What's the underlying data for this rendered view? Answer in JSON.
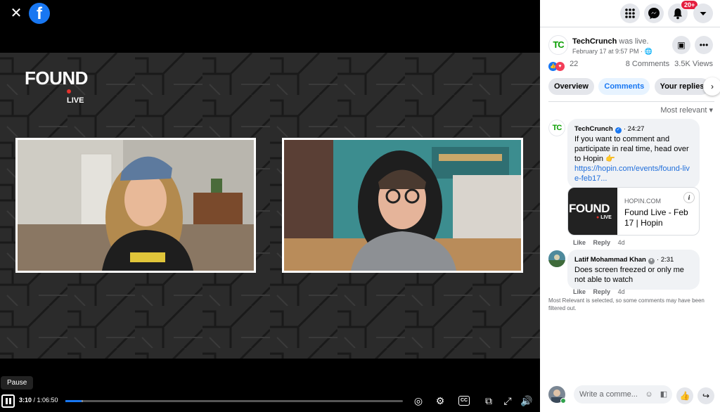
{
  "video": {
    "close_icon": "close-icon",
    "logo_letter": "f",
    "brand_title": "FOUND",
    "brand_live": "LIVE",
    "tooltip": "Pause",
    "time_current": "3:10",
    "time_total": "1:06:50",
    "progress_fraction": 0.047,
    "buffer_fraction": 0.052,
    "cc_label": "CC"
  },
  "topbar": {
    "notif_badge": "20+"
  },
  "post": {
    "page_name": "TechCrunch",
    "page_logo": "TC",
    "status": "was live.",
    "timestamp": "February 17 at 9:57 PM ·",
    "reactions_count": "22",
    "comments_count": "8 Comments",
    "views_count": "3.5K Views"
  },
  "tabs": [
    {
      "label": "Overview"
    },
    {
      "label": "Comments"
    },
    {
      "label": "Your replies"
    }
  ],
  "sort_label": "Most relevant",
  "comments": [
    {
      "author": "TechCrunch",
      "time": "24:27",
      "text": "If you want to comment and participate in real time, head over to Hopin 👉",
      "link": "https://hopin.com/events/found-live-feb17...",
      "card": {
        "domain": "HOPIN.COM",
        "title": "Found Live - Feb 17 | Hopin",
        "thumb_title": "FOUND",
        "thumb_live": "LIVE"
      },
      "like": "Like",
      "reply": "Reply",
      "age": "4d"
    },
    {
      "author": "Latif Mohammad Khan",
      "time": "2:31",
      "text": "Does screen freezed or only me not able to watch",
      "like": "Like",
      "reply": "Reply",
      "age": "4d"
    }
  ],
  "filter_note": "Most Relevant is selected, so some comments may have been filtered out.",
  "composer": {
    "placeholder": "Write a comme..."
  }
}
